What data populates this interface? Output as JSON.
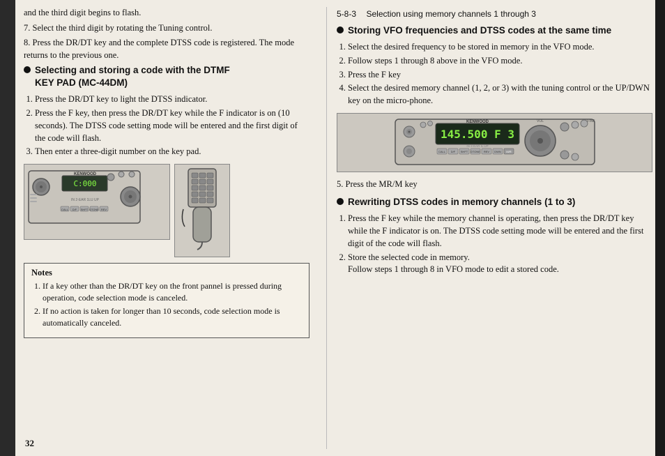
{
  "page": {
    "number": "32",
    "left_column": {
      "intro_lines": [
        "and the third digit begins to flash.",
        "7. Select the third digit by rotating the Tuning control.",
        "8. Press the DR/DT key and the complete DTSS code is registered. The mode returns to the previous one."
      ],
      "section_title": "Selecting and storing a code with the DTMF KEY PAD (MC-44DM)",
      "steps": [
        "Press the DR/DT key to light the DTSS indicator.",
        "Press the F key, then press the DR/DT key while the F indicator is on (10 seconds). The DTSS code setting mode will be entered and the first digit of the code will flash.",
        "Then enter a three-digit number on the key pad."
      ],
      "notes": {
        "title": "Notes",
        "items": [
          "If a key other than the DR/DT key on the front pannel is pressed during operation, code selection mode is canceled.",
          "If no action is taken for longer than 10 seconds, code selection mode is automatically canceled."
        ]
      }
    },
    "right_column": {
      "section_number": "5-8-3",
      "section_title": "Selection using memory channels 1 through 3",
      "sub_sections": [
        {
          "title": "Storing VFO frequencies and DTSS codes at the same time",
          "steps": [
            "Select the desired frequency to be stored in memory in the VFO mode.",
            "Follow steps 1 through 8 above in the VFO mode.",
            "Press the F key",
            "Select the desired memory channel (1, 2, or 3) with the tuning control or the UP/DWN key on the micro-phone.",
            "Press the MR/M key"
          ]
        },
        {
          "title": "Rewriting DTSS codes in memory channels (1 to 3)",
          "steps": [
            "Press the F key while the memory channel is operating, then press the DR/DT key while the F indicator is on. The DTSS code setting mode will be entered and the first digit of the code will flash.",
            "Store the selected code in memory. Follow steps 1 through 8 in VFO mode to edit a stored code."
          ]
        }
      ],
      "display_reading": "145.500 F 3"
    }
  }
}
